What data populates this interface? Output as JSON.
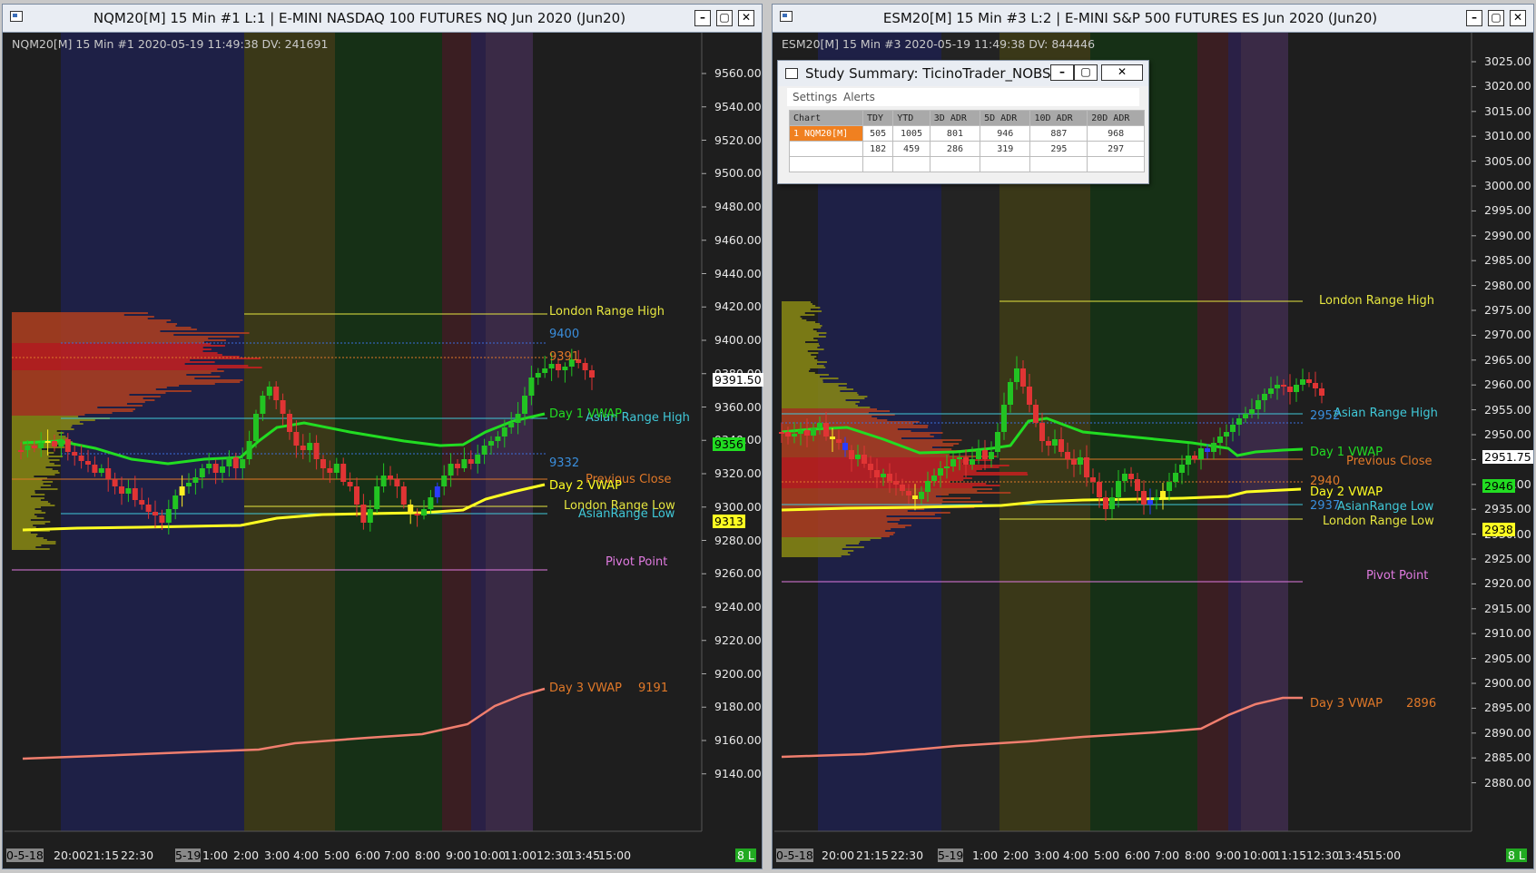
{
  "windows": [
    {
      "title": "NQM20[M]  15 Min  #1  L:1 | E-MINI NASDAQ 100 FUTURES NQ Jun 2020 (Jun20)",
      "header": "NQM20[M]  15 Min  #1 2020-05-19 11:49:38 DV: 241691",
      "price_axis": [
        "9560.00",
        "9540.00",
        "9520.00",
        "9500.00",
        "9480.00",
        "9460.00",
        "9440.00",
        "9420.00",
        "9400.00",
        "9380.00",
        "9360.00",
        "9340.00",
        "9320.00",
        "9300.00",
        "9280.00",
        "9260.00",
        "9240.00",
        "9220.00",
        "9200.00",
        "9180.00",
        "9160.00",
        "9140.00"
      ],
      "time_axis": [
        "0-5-18",
        "20:00",
        "21:15",
        "22:30",
        "5-19",
        "1:00",
        "2:00",
        "3:00",
        "4:00",
        "5:00",
        "6:00",
        "7:00",
        "8:00",
        "9:00",
        "10:00",
        "11:00",
        "12:30",
        "13:45",
        "15:00"
      ],
      "bars_badge": "8 L",
      "current_price": "9391.50",
      "levels": {
        "london_high": "London Range High",
        "n9400": "9400",
        "n9391": "9391",
        "asian_high": "Asian Range High",
        "day1_vwap": "Day 1 VWAP",
        "tag_day1": "9356",
        "n9332": "9332",
        "prev_close": "Previous Close",
        "day2_vwap": "Day 2 VWAP",
        "tag_day2": "9313",
        "london_low": "London Range Low",
        "asian_low": "AsianRange Low",
        "pivot": "Pivot Point",
        "day3_vwap": "Day 3 VWAP",
        "n_day3": "9191"
      }
    },
    {
      "title": "ESM20[M]  15 Min  #3  L:2 | E-MINI S&P 500 FUTURES ES Jun 2020 (Jun20)",
      "header": "ESM20[M]  15 Min  #3 2020-05-19 11:49:38 DV: 844446",
      "price_axis": [
        "3025.00",
        "3020.00",
        "3015.00",
        "3010.00",
        "3005.00",
        "3000.00",
        "2995.00",
        "2990.00",
        "2985.00",
        "2980.00",
        "2975.00",
        "2970.00",
        "2965.00",
        "2960.00",
        "2955.00",
        "2950.00",
        "2945.00",
        "2940.00",
        "2935.00",
        "2930.00",
        "2925.00",
        "2920.00",
        "2915.00",
        "2910.00",
        "2905.00",
        "2900.00",
        "2895.00",
        "2890.00",
        "2885.00",
        "2880.00"
      ],
      "time_axis": [
        "0-5-18",
        "20:00",
        "21:15",
        "22:30",
        "5-19",
        "1:00",
        "2:00",
        "3:00",
        "4:00",
        "5:00",
        "6:00",
        "7:00",
        "8:00",
        "9:00",
        "10:00",
        "11:15",
        "12:30",
        "13:45",
        "15:00"
      ],
      "bars_badge": "8 L",
      "current_price": "2951.75",
      "levels": {
        "london_high": "London Range High",
        "asian_high": "Asian Range High",
        "n2952": "2952",
        "day1_vwap": "Day 1 VWAP",
        "tag_day1": "2946",
        "prev_close": "Previous Close",
        "n2940": "2940",
        "day2_vwap": "Day 2 VWAP",
        "tag_day2": "2938",
        "n2937": "2937",
        "asian_low": "AsianRange Low",
        "london_low": "London Range Low",
        "pivot": "Pivot Point",
        "day3_vwap": "Day 3 VWAP",
        "n_day3": "2896"
      }
    }
  ],
  "study_summary": {
    "title": "Study Summary: TicinoTrader_NOBS-V...",
    "menu": [
      "Settings",
      "Alerts"
    ],
    "headers": [
      "Chart",
      "TDY",
      "YTD",
      "3D ADR",
      "5D ADR",
      "10D ADR",
      "20D ADR"
    ],
    "rows": [
      [
        "1  NQM20[M]",
        "505",
        "1005",
        "801",
        "946",
        "887",
        "968"
      ],
      [
        "",
        "182",
        "459",
        "286",
        "319",
        "295",
        "297"
      ]
    ]
  },
  "colors": {
    "background": "#1e1e1e",
    "candle_up": "#22c322",
    "candle_down": "#e03434",
    "vwap_day1": "#22dd22",
    "vwap_day2": "#ffff22",
    "vwap_day3": "#f07e6e",
    "london": "#e6e640",
    "asian": "#40c8d8",
    "pivot": "#e07ae0",
    "prev_close": "#e07828"
  }
}
